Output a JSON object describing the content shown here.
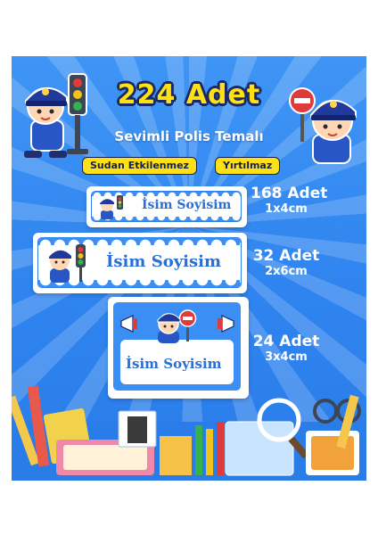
{
  "title": "224 Adet",
  "subtitle": "Sevimli Polis Temalı",
  "badges": [
    "Sudan Etkilenmez",
    "Yırtılmaz"
  ],
  "labels": [
    {
      "name": "İsim Soyisim",
      "qty": "168 Adet",
      "size": "1x4cm"
    },
    {
      "name": "İsim Soyisim",
      "qty": "32 Adet",
      "size": "2x6cm"
    },
    {
      "name": "İsim Soyisim",
      "qty": "24 Adet",
      "size": "3x4cm"
    }
  ],
  "colors": {
    "background": "#3b8ff4",
    "accent": "#ffe014",
    "outline": "#1a2a66",
    "text_blue": "#2a6fd6"
  },
  "icons": [
    "police-officer-traffic-light-icon",
    "police-officer-stop-sign-icon",
    "school-supplies-icon",
    "megaphone-icon"
  ]
}
